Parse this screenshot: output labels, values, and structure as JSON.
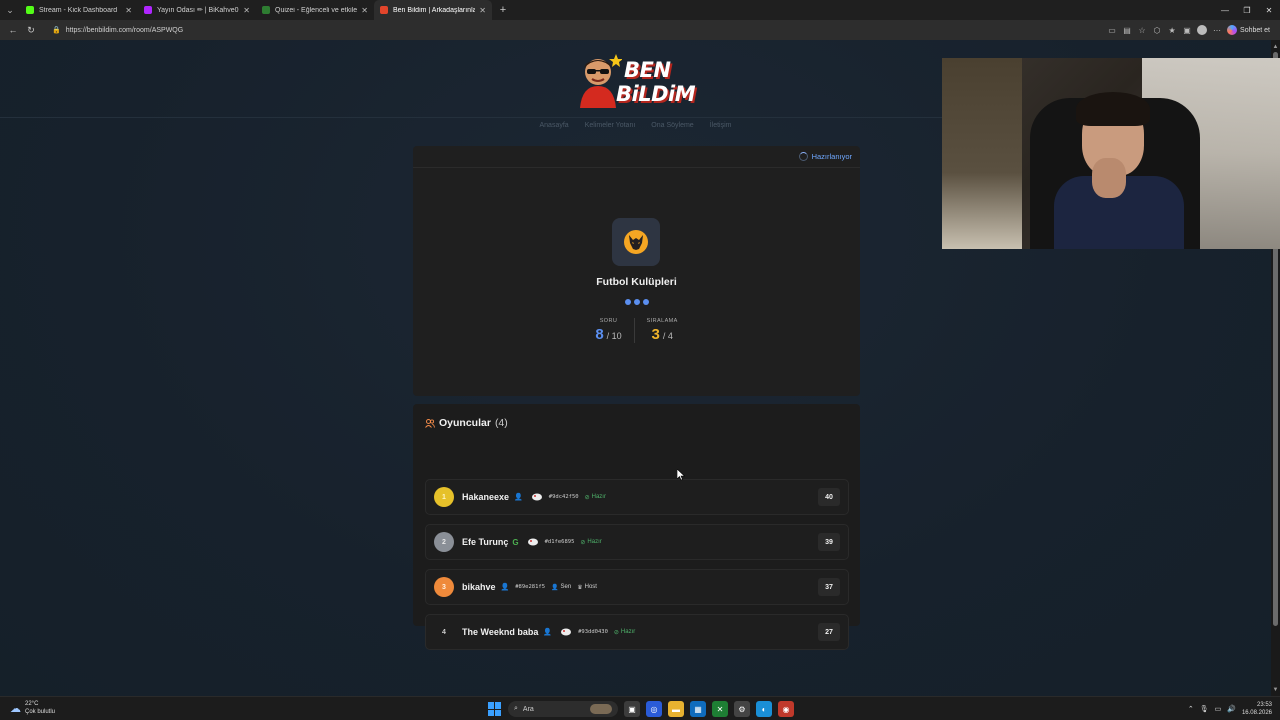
{
  "browser": {
    "tabs": [
      {
        "label": "Stream - Kick Dashboard",
        "color": "#53fc18",
        "active": false
      },
      {
        "label": "Yayın Odası ✏ | BiKahve0",
        "color": "#b026ff",
        "active": false
      },
      {
        "label": "Quizei - Eğlenceli ve etkileşimli qu",
        "color": "#2e7d32",
        "active": false
      },
      {
        "label": "Ben Bildim | Arkadaşlarınla Online",
        "color": "#e2452b",
        "active": true
      }
    ],
    "url": "https://benbildim.com/room/ASPWQG",
    "copilot_label": "Sohbet et"
  },
  "site": {
    "logo_word1": "BEN",
    "logo_word2": "BiLDiM",
    "nav": [
      "Anasayfa",
      "Kelimeler Yotanı",
      "Ona Söyleme",
      "İletişim"
    ]
  },
  "quiz": {
    "status": "Hazırlanıyor",
    "category": "Futbol Kulüpleri",
    "question_label": "SORU",
    "question_current": "8",
    "question_total": "/ 10",
    "rank_label": "SIRALAMA",
    "rank_current": "3",
    "rank_total": "/ 4"
  },
  "players": {
    "title": "Oyuncular",
    "count": "(4)",
    "rows": [
      {
        "rank": "1",
        "name": "Hakaneexe",
        "hash": "#9dc42f50",
        "badge": "Hazır",
        "score": "40"
      },
      {
        "rank": "2",
        "name": "Efe Turunç",
        "hash": "#d1fe6895",
        "badge": "Hazır",
        "score": "39"
      },
      {
        "rank": "3",
        "name": "bikahve",
        "hash": "#89e281f5",
        "badge_sen": "Sen",
        "badge_host": "Host",
        "score": "37"
      },
      {
        "rank": "4",
        "name": "The Weeknd baba",
        "hash": "#93dd0430",
        "badge": "Hazır",
        "score": "27"
      }
    ]
  },
  "taskbar": {
    "temp": "22°C",
    "weather": "Çok bulutlu",
    "search": "Ara",
    "time": "23:53",
    "date": "16.08.2026"
  }
}
